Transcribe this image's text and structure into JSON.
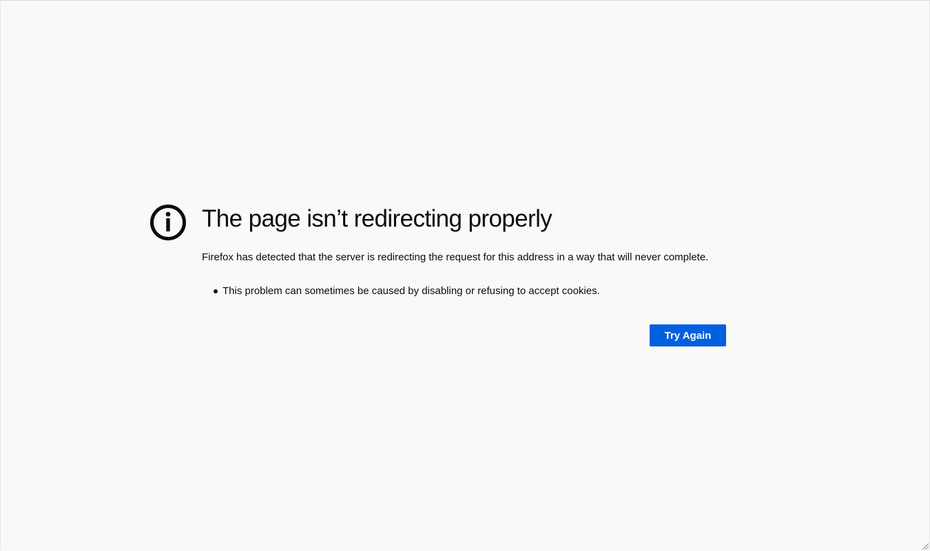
{
  "error": {
    "icon": "info-icon",
    "title": "The page isn’t redirecting properly",
    "description": "Firefox has detected that the server is redirecting the request for this address in a way that will never complete.",
    "hints": [
      "This problem can sometimes be caused by disabling or refusing to accept cookies."
    ],
    "try_again_label": "Try Again"
  },
  "colors": {
    "background": "#f9f9fa",
    "text": "#0c0c0d",
    "button": "#0060df",
    "button_text": "#ffffff"
  }
}
